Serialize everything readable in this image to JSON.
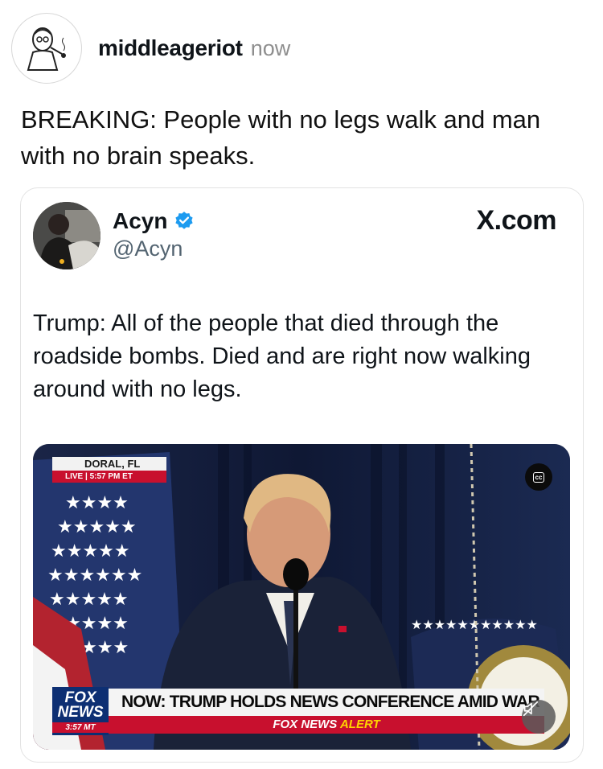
{
  "post": {
    "username": "middleageriot",
    "time": "now",
    "caption": "BREAKING: People with no legs walk and man with no brain speaks."
  },
  "embed": {
    "author_name": "Acyn",
    "author_handle": "@Acyn",
    "source": "X.com",
    "text": "Trump: All of the people that died through the roadside bombs. Died and are right now walking around with no legs.",
    "video": {
      "location": "DORAL, FL",
      "live_label": "LIVE",
      "live_time": "5:57 PM ET",
      "cc_label": "cc",
      "channel_line1": "FOX",
      "channel_line2": "NEWS",
      "channel_time": "3:57 MT",
      "headline": "NOW: TRUMP HOLDS NEWS CONFERENCE AMID WAR IN IRAN",
      "alert_prefix": "FOX NEWS",
      "alert_word": "ALERT"
    }
  },
  "icons": {
    "avatar": "cartoon-man-avatar-icon",
    "verified": "verified-badge-icon",
    "cc": "closed-captions-icon",
    "mute": "muted-speaker-icon"
  },
  "colors": {
    "verified_blue": "#1d9bf0",
    "fox_red": "#c8102e",
    "fox_blue": "#0d2f73",
    "alert_yellow": "#ffd400"
  }
}
